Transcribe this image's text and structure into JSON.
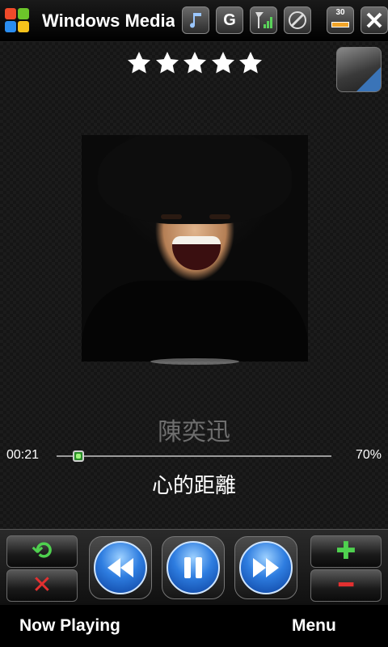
{
  "titlebar": {
    "app_title": "Windows Media",
    "icons": [
      "windows-start-icon",
      "music-note-icon",
      "gprs-g-icon",
      "signal-strength-icon",
      "volume-icon",
      "battery-icon",
      "close-icon"
    ],
    "g_label": "G",
    "battery_label": "30"
  },
  "player": {
    "rating_stars": 5,
    "artist": "陳奕迅",
    "song_title": "心的距離",
    "elapsed": "00:21",
    "volume_percent_label": "70%",
    "progress_fraction": 0.08
  },
  "controls": {
    "repeat_icon": "repeat-icon",
    "shuffle_icon": "shuffle-icon",
    "previous_icon": "rewind-icon",
    "play_pause_icon": "pause-icon",
    "next_icon": "fast-forward-icon",
    "volume_up_icon": "plus-icon",
    "volume_down_icon": "minus-icon"
  },
  "softkeys": {
    "left": "Now Playing",
    "right": "Menu"
  },
  "colors": {
    "accent_blue": "#2e7de0",
    "green": "#4fd04f",
    "red": "#e23030",
    "battery_orange": "#f2a52a"
  }
}
